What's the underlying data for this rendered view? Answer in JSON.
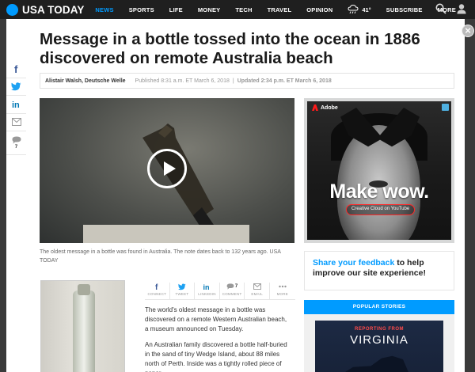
{
  "header": {
    "brand": "USA TODAY",
    "nav": [
      "NEWS",
      "SPORTS",
      "LIFE",
      "MONEY",
      "TECH",
      "TRAVEL",
      "OPINION"
    ],
    "active_nav": "NEWS",
    "weather_temp": "41°",
    "subscribe": "SUBSCRIBE",
    "more": "MORE",
    "brand_color": "#009bff"
  },
  "share_rail": {
    "comments_count": "7"
  },
  "article": {
    "headline": "Message in a bottle tossed into the ocean in 1886 discovered on remote Australia beach",
    "author": "Alistair Walsh, Deutsche Welle",
    "published": "Published 8:31 a.m. ET March 6, 2018",
    "separator": "|",
    "updated": "Updated 2:34 p.m. ET March 6, 2018",
    "video_caption": "The oldest message in a bottle was found in Australia. The note dates back to 132 years ago. USA TODAY",
    "paragraphs": [
      "The world's oldest message in a bottle was discovered on a remote Western Australian beach, a museum announced on Tuesday.",
      "An Australian family discovered a bottle half-buried in the sand of tiny Wedge Island, about 88 miles north of Perth. Inside was a tightly rolled piece of paper."
    ]
  },
  "share_bar": [
    {
      "label": "CONNECT",
      "icon": "facebook-icon"
    },
    {
      "label": "TWEET",
      "icon": "twitter-icon"
    },
    {
      "label": "LINKEDIN",
      "icon": "linkedin-icon"
    },
    {
      "label": "COMMENT",
      "icon": "comment-icon",
      "count": "7"
    },
    {
      "label": "EMAIL",
      "icon": "email-icon"
    },
    {
      "label": "MORE",
      "icon": "more-icon"
    }
  ],
  "ad": {
    "brand": "Adobe",
    "headline": "Make wow.",
    "cta": "Creative Cloud on YouTube"
  },
  "feedback": {
    "link_text": "Share your feedback",
    "rest_text": " to help improve our site experience!"
  },
  "popular": {
    "heading": "POPULAR STORIES",
    "kicker": "REPORTING FROM",
    "title": "VIRGINIA"
  },
  "close_label": "×"
}
